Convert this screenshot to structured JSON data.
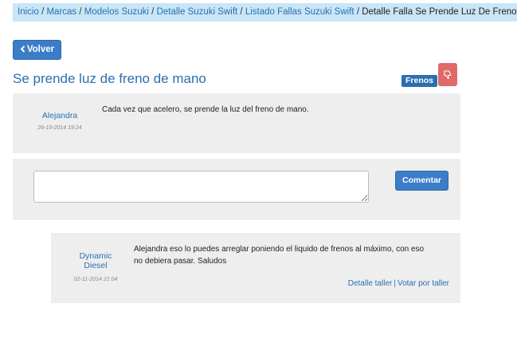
{
  "breadcrumb": {
    "items": [
      "Inicio",
      "Marcas",
      "Modelos Suzuki",
      "Detalle Suzuki Swift",
      "Listado Fallas Suzuki Swift"
    ],
    "current": "Detalle Falla Se Prende Luz De Freno De Mano",
    "separator": "/"
  },
  "toolbar": {
    "back_label": "Volver",
    "back_icon": "chevron-left-icon"
  },
  "issue": {
    "title": "Se prende luz de freno de mano",
    "category_badge": "Frenos",
    "dislike_icon": "thumbs-down-icon",
    "author": "Alejandra",
    "date": "26-10-2014 19:24",
    "text": "Cada vez que acelero, se prende la luz del freno de mano."
  },
  "comment_form": {
    "input_value": "",
    "button_label": "Comentar"
  },
  "answer": {
    "author_line1": "Dynamic",
    "author_line2": "Diesel",
    "date": "02-11-2014 21:04",
    "text_line1": "Alejandra eso lo puedes arreglar poniendo el liquido de frenos al máximo, con eso",
    "text_line2": "no debiera pasar. Saludos",
    "link_detail": "Detalle taller",
    "link_separator": "|",
    "link_vote": "Votar por taller"
  },
  "colors": {
    "accent": "#2a6fb0",
    "button": "#3b7dc8",
    "breadcrumb_bg": "#c9e6f7",
    "danger": "#e06a6a",
    "panel_bg": "#eeeeee"
  }
}
